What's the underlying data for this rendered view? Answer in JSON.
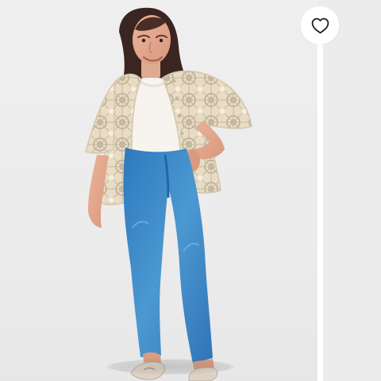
{
  "product_gallery": {
    "favorite_button": {
      "icon": "heart-icon",
      "state": "unselected"
    },
    "image_subject": "model-wearing-crochet-cardigan-white-top-blue-jeans"
  },
  "colors": {
    "background": "#ececed",
    "card": "#ffffff",
    "icon": "#1f1f1f",
    "denim": "#3d8ac8",
    "crochet": "#e9dcc4",
    "top": "#f7f4ef"
  }
}
